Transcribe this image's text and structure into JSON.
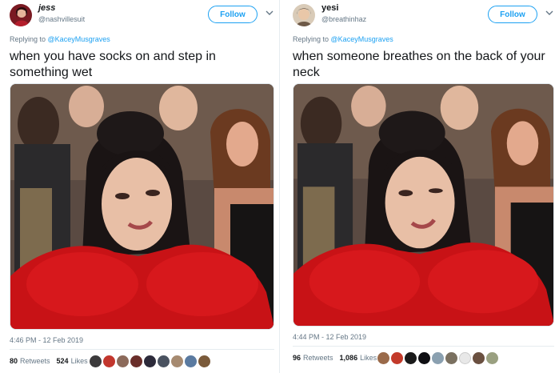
{
  "tweets": [
    {
      "name": "jess",
      "handle": "@nashvillesuit",
      "follow_label": "Follow",
      "reply_prefix": "Replying to",
      "reply_mention": "@KaceyMusgraves",
      "text": "when you have socks on and step in something wet",
      "timestamp": "4:46 PM - 12 Feb 2019",
      "retweets": "80",
      "retweets_label": "Retweets",
      "likes": "524",
      "likes_label": "Likes"
    },
    {
      "name": "yesi",
      "handle": "@breathinhaz",
      "follow_label": "Follow",
      "reply_prefix": "Replying to",
      "reply_mention": "@KaceyMusgraves",
      "text": "when someone breathes on the back of your neck",
      "timestamp": "4:44 PM - 12 Feb 2019",
      "retweets": "96",
      "retweets_label": "Retweets",
      "likes": "1,086",
      "likes_label": "Likes"
    }
  ],
  "colors": {
    "accent": "#1da1f2",
    "muted": "#657786",
    "text": "#14171a",
    "dress_red": "#c81216"
  },
  "icons": [
    "chevron-down-icon"
  ]
}
